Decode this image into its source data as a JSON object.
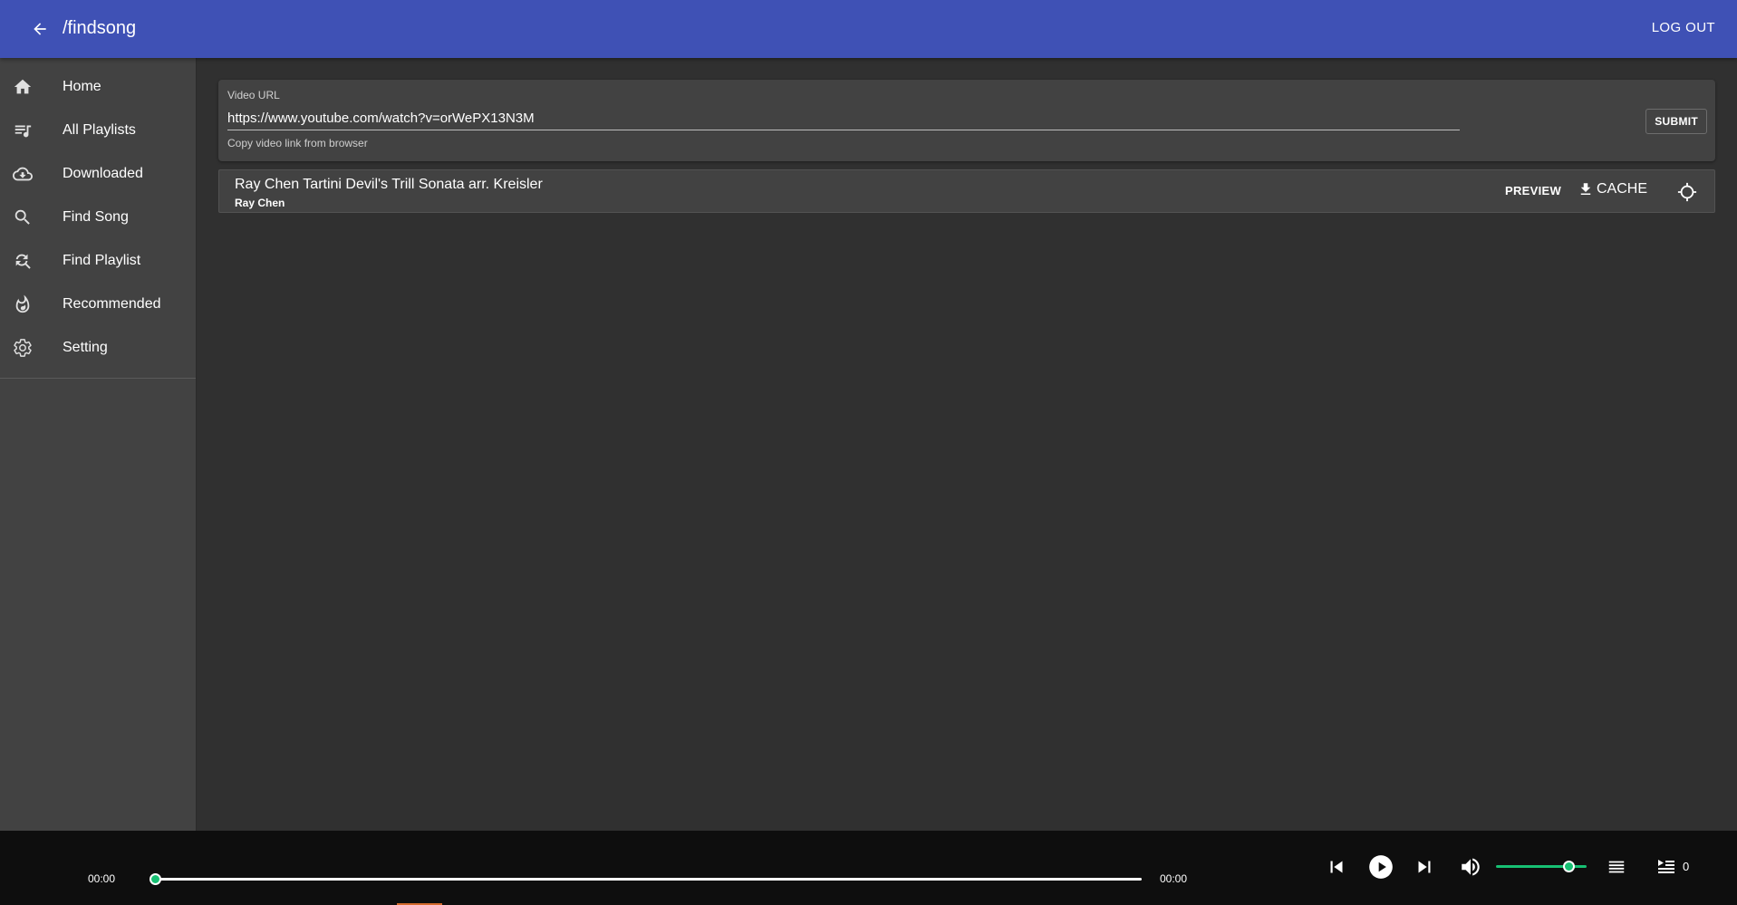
{
  "appbar": {
    "title": "/findsong",
    "logout_label": "LOG OUT",
    "color": "#3f51b5"
  },
  "sidebar": {
    "items": [
      {
        "label": "Home",
        "icon": "home-icon"
      },
      {
        "label": "All Playlists",
        "icon": "playlist-icon"
      },
      {
        "label": "Downloaded",
        "icon": "cloud-download-icon"
      },
      {
        "label": "Find Song",
        "icon": "search-icon"
      },
      {
        "label": "Find Playlist",
        "icon": "find-replace-icon"
      },
      {
        "label": "Recommended",
        "icon": "fire-icon"
      },
      {
        "label": "Setting",
        "icon": "gear-icon"
      }
    ]
  },
  "search": {
    "label": "Video URL",
    "value": "https://www.youtube.com/watch?v=orWePX13N3M",
    "helper": "Copy video link from browser",
    "submit_label": "SUBMIT"
  },
  "result": {
    "title": "Ray Chen Tartini Devil's Trill Sonata arr. Kreisler",
    "artist": "Ray Chen",
    "preview_label": "PREVIEW",
    "cache_label": "CACHE"
  },
  "player": {
    "current_time": "00:00",
    "total_time": "00:00",
    "progress": 0,
    "volume": 0.8,
    "queue_count": "0",
    "accent": "#17c073"
  }
}
